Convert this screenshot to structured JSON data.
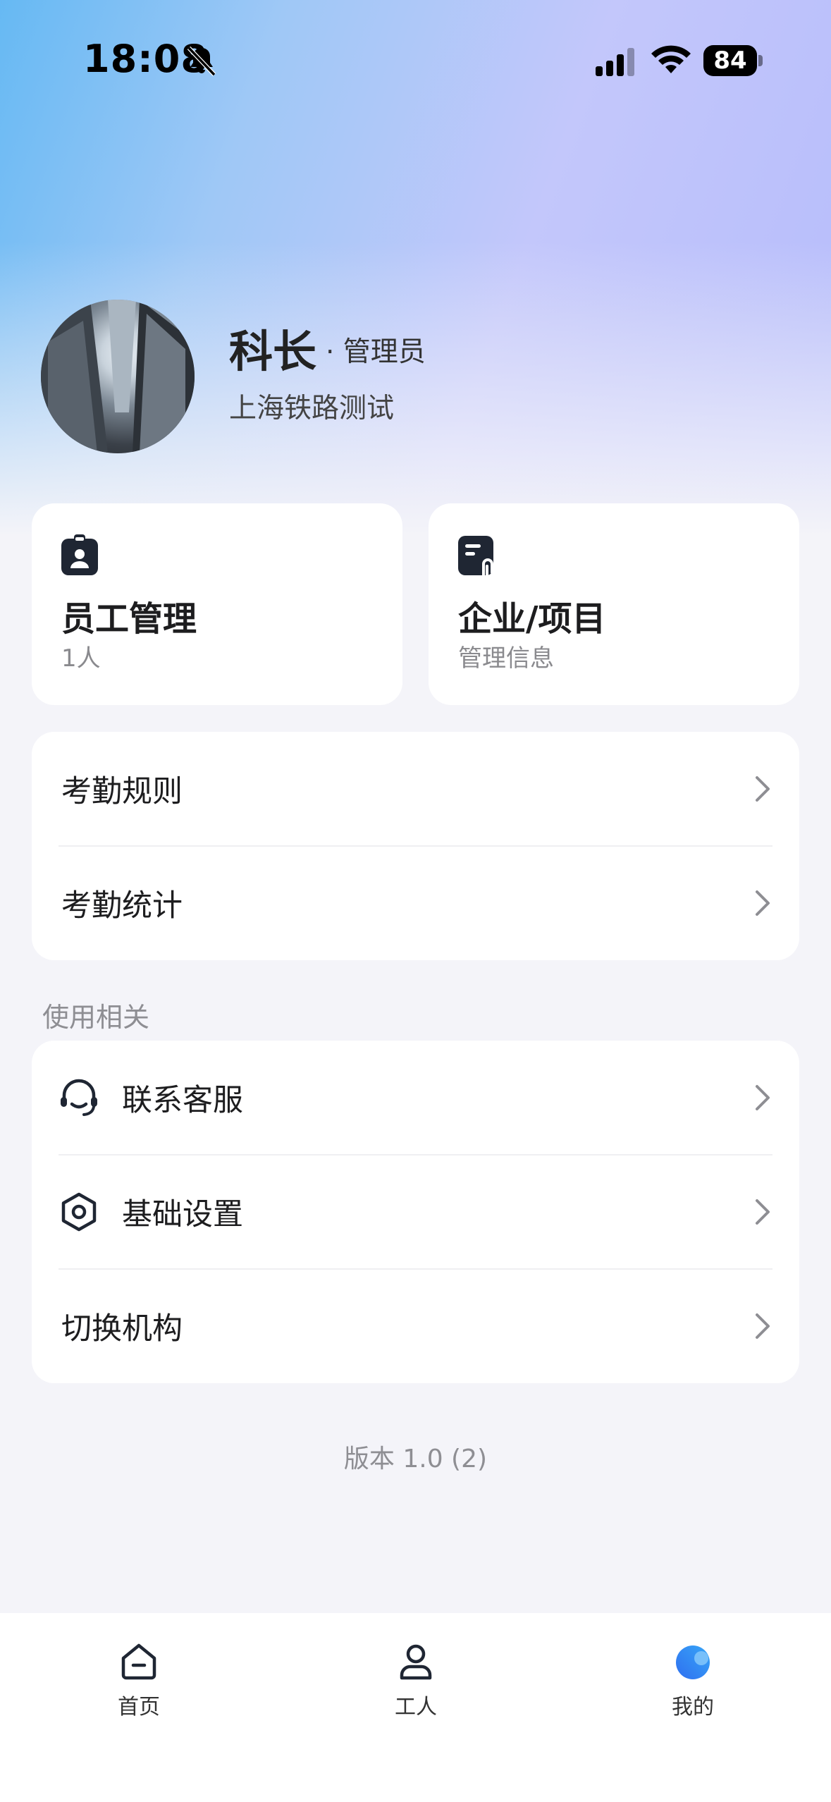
{
  "status_bar": {
    "time": "18:08",
    "battery": "84",
    "icons": [
      "bell-slash-icon",
      "cellular-signal-icon",
      "wifi-icon",
      "battery-icon"
    ]
  },
  "profile": {
    "name": "科长",
    "role": "· 管理员",
    "organization": "上海铁路测试"
  },
  "quick_cards": [
    {
      "title": "员工管理",
      "subtitle": "1人",
      "icon": "employee-badge-icon"
    },
    {
      "title": "企业/项目",
      "subtitle": "管理信息",
      "icon": "document-attachment-icon"
    }
  ],
  "attendance_menu": [
    {
      "label": "考勤规则"
    },
    {
      "label": "考勤统计"
    }
  ],
  "usage_section": {
    "title": "使用相关",
    "items": [
      {
        "label": "联系客服",
        "icon": "headset-icon"
      },
      {
        "label": "基础设置",
        "icon": "settings-hexagon-icon"
      },
      {
        "label": "切换机构"
      }
    ]
  },
  "version": "版本 1.0 (2)",
  "tab_bar": {
    "tabs": [
      {
        "label": "首页",
        "icon": "home-icon",
        "active": false
      },
      {
        "label": "工人",
        "icon": "person-icon",
        "active": false
      },
      {
        "label": "我的",
        "icon": "profile-blob-icon",
        "active": true
      }
    ]
  },
  "colors": {
    "accent": "#2f7cf6",
    "background": "#f4f4f9",
    "icon_dark": "#1f2633"
  }
}
